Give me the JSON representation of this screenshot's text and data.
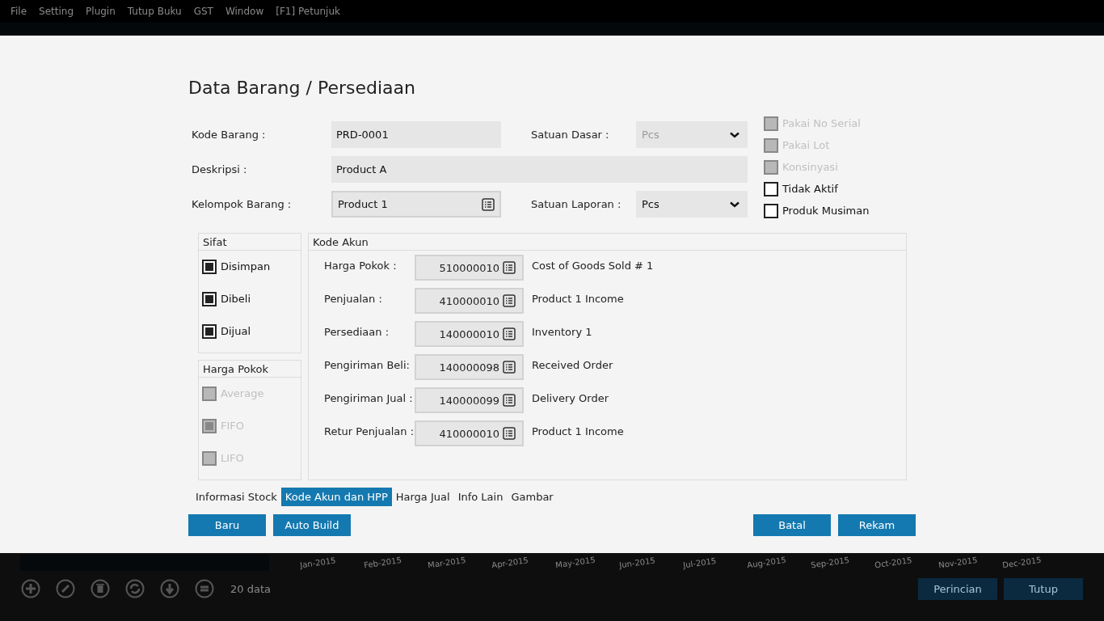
{
  "menu_bar": {
    "items": [
      "File",
      "Setting",
      "Plugin",
      "Tutup Buku",
      "GST",
      "Window",
      "[F1] Petunjuk"
    ]
  },
  "dialog": {
    "title": "Data Barang / Persediaan",
    "form_rows": [
      [
        {
          "label": "Kode Barang :",
          "value": "PRD-0001",
          "kind": "text",
          "disabled": false
        },
        {
          "label": "Satuan Dasar :",
          "value": "Pcs",
          "kind": "dropdown",
          "disabled": true
        }
      ],
      [
        {
          "label": "Deskripsi :",
          "value": "Product A",
          "kind": "text",
          "disabled": false
        }
      ],
      [
        {
          "label": "Kelompok Barang :",
          "value": "Product 1",
          "kind": "lookup",
          "disabled": false
        },
        {
          "label": "Satuan Laporan :",
          "value": "Pcs",
          "kind": "dropdown",
          "disabled": false
        }
      ]
    ],
    "options": [
      {
        "label": "Pakai No Serial",
        "checked": false,
        "disabled": true
      },
      {
        "label": "Pakai Lot",
        "checked": false,
        "disabled": true
      },
      {
        "label": "Konsinyasi",
        "checked": false,
        "disabled": true
      },
      {
        "label": "Tidak Aktif",
        "checked": false,
        "disabled": false
      },
      {
        "label": "Produk Musiman",
        "checked": false,
        "disabled": false
      }
    ],
    "sifat": {
      "title": "Sifat",
      "items": [
        {
          "label": "Disimpan",
          "checked": true,
          "disabled": false
        },
        {
          "label": "Dibeli",
          "checked": true,
          "disabled": false
        },
        {
          "label": "Dijual",
          "checked": true,
          "disabled": false
        }
      ]
    },
    "harga_pokok": {
      "title": "Harga Pokok",
      "items": [
        {
          "label": "Average",
          "checked": false,
          "disabled": true
        },
        {
          "label": "FIFO",
          "checked": true,
          "disabled": true
        },
        {
          "label": "LIFO",
          "checked": false,
          "disabled": true
        }
      ]
    },
    "kode_akun": {
      "title": "Kode Akun",
      "rows": [
        {
          "label": "Harga Pokok :",
          "code": "510000010",
          "name": "Cost of Goods Sold # 1"
        },
        {
          "label": "Penjualan :",
          "code": "410000010",
          "name": "Product 1 Income"
        },
        {
          "label": "Persediaan :",
          "code": "140000010",
          "name": "Inventory 1"
        },
        {
          "label": "Pengiriman Beli:",
          "code": "140000098",
          "name": "Received Order"
        },
        {
          "label": "Pengiriman Jual :",
          "code": "140000099",
          "name": "Delivery Order"
        },
        {
          "label": "Retur Penjualan :",
          "code": "410000010",
          "name": "Product 1 Income"
        }
      ]
    },
    "tabs": [
      {
        "label": "Informasi Stock",
        "selected": false
      },
      {
        "label": "Kode Akun dan HPP",
        "selected": true
      },
      {
        "label": "Harga Jual",
        "selected": false
      },
      {
        "label": "Info Lain",
        "selected": false
      },
      {
        "label": "Gambar",
        "selected": false
      }
    ],
    "left_buttons": [
      "Baru",
      "Auto Build"
    ],
    "right_buttons": [
      "Batal",
      "Rekam"
    ]
  },
  "background": {
    "month_labels": [
      "Jan-2015",
      "Feb-2015",
      "Mar-2015",
      "Apr-2015",
      "May-2015",
      "Jun-2015",
      "Jul-2015",
      "Aug-2015",
      "Sep-2015",
      "Oct-2015",
      "Nov-2015",
      "Dec-2015"
    ],
    "count": "20 data",
    "buttons": [
      "Perincian",
      "Tutup"
    ]
  }
}
